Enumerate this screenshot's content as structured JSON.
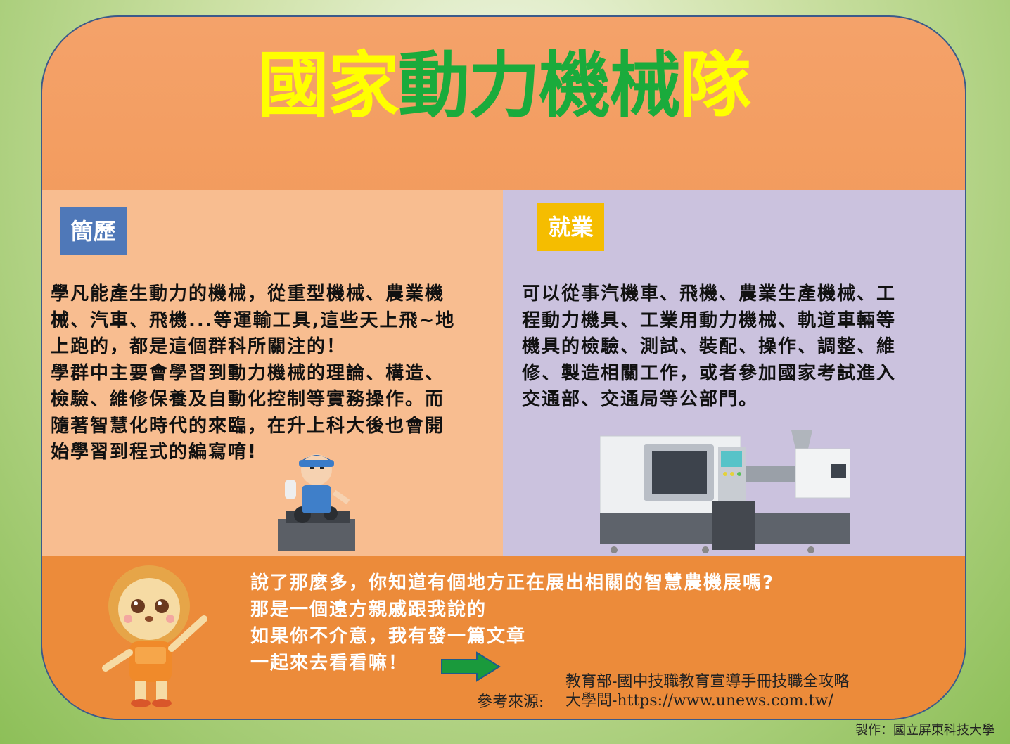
{
  "title": {
    "part1": "國家",
    "part2": "動力機械",
    "part3": "隊"
  },
  "colors": {
    "title_yellow": "#ffff00",
    "title_green": "#1aab3c",
    "left_panel": "#f8bd90",
    "right_panel": "#cbc2de",
    "band": "#ec8b3a"
  },
  "left": {
    "tag": "簡歷",
    "text": "學凡能產生動力的機械，從重型機械、農業機\n械、汽車、飛機...等運輸工具,這些天上飛~地\n上跑的，都是這個群科所關注的！\n學群中主要會學習到動力機械的理論、構造、\n檢驗、維修保養及自動化控制等實務操作。而\n隨著智慧化時代的來臨，在升上科大後也會開\n始學習到程式的編寫唷!"
  },
  "right": {
    "tag": "就業",
    "text": "可以從事汽機車、飛機、農業生產機械、工\n程動力機具、工業用動力機械、軌道車輛等\n機具的檢驗、測試、裝配、操作、調整、維\n修、製造相關工作，或者參加國家考試進入\n交通部、交通局等公部門。"
  },
  "bottom": {
    "lines": [
      "說了那麼多，你知道有個地方正在展出相關的智慧農機展嗎?",
      "那是一個遠方親戚跟我說的",
      "如果你不介意，我有發一篇文章",
      "一起來去看看嘛！"
    ],
    "arrow_icon": "right-arrow-icon",
    "ref_label": "參考來源:",
    "refs": [
      "教育部-國中技職教育宣導手冊技職全攻略",
      "大學問-https://www.unews.com.tw/"
    ]
  },
  "footer": "製作：國立屏東科技大學"
}
